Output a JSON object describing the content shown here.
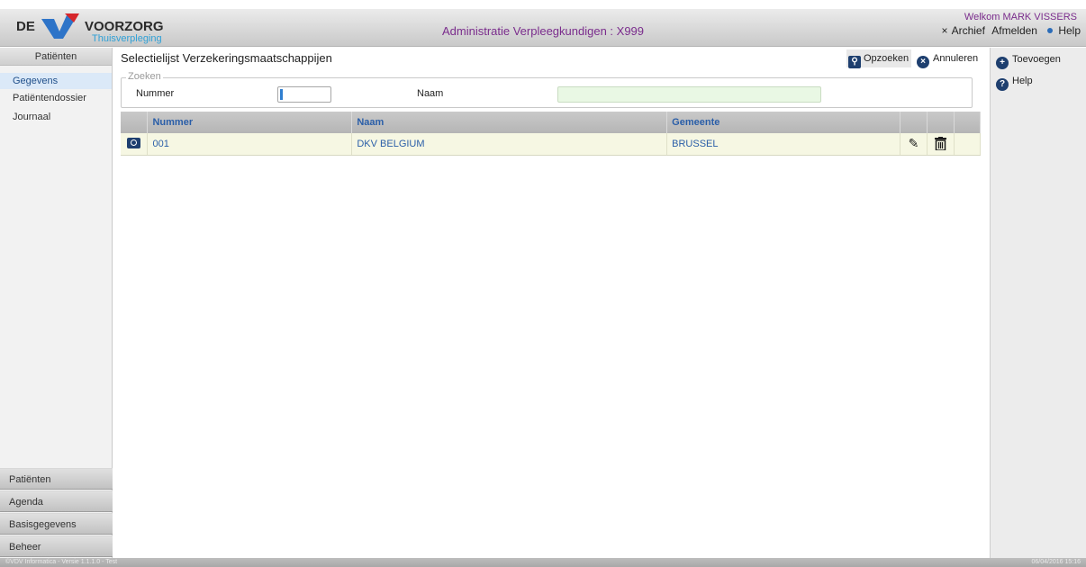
{
  "header": {
    "logo_de": "DE",
    "logo_voorzorg": "VOORZORG",
    "logo_sub": "Thuisverpleging",
    "app_title": "Administratie Verpleegkundigen : X999",
    "welcome": "Welkom MARK VISSERS",
    "links": {
      "archief": "Archief",
      "afmelden": "Afmelden",
      "help": "Help"
    }
  },
  "sidebar": {
    "header": "Patiënten",
    "items": [
      {
        "label": "Gegevens",
        "active": true
      },
      {
        "label": "Patiëntendossier"
      },
      {
        "label": "Journaal"
      }
    ],
    "bottom": [
      "Patiënten",
      "Agenda",
      "Basisgegevens",
      "Beheer"
    ]
  },
  "main": {
    "title": "Selectielijst Verzekeringsmaatschappijen",
    "buttons": {
      "opzoeken": "Opzoeken",
      "annuleren": "Annuleren"
    },
    "search": {
      "legend": "Zoeken",
      "nummer_label": "Nummer",
      "nummer_value": "",
      "naam_label": "Naam",
      "naam_value": ""
    },
    "table": {
      "columns": [
        "Nummer",
        "Naam",
        "Gemeente"
      ],
      "rows": [
        {
          "nummer": "001",
          "naam": "DKV BELGIUM",
          "gemeente": "BRUSSEL"
        }
      ]
    }
  },
  "right_panel": {
    "toevoegen": "Toevoegen",
    "help": "Help"
  },
  "footer": {
    "left": "©VDV Informatica - Versie 1.1.1.0 - Test",
    "right": "06/04/2016 15:16"
  },
  "colors": {
    "accent": "#1e3f6f",
    "title_purple": "#7a2c8c",
    "link_blue": "#2a5ea8",
    "row_bg": "#f6f7e3"
  }
}
